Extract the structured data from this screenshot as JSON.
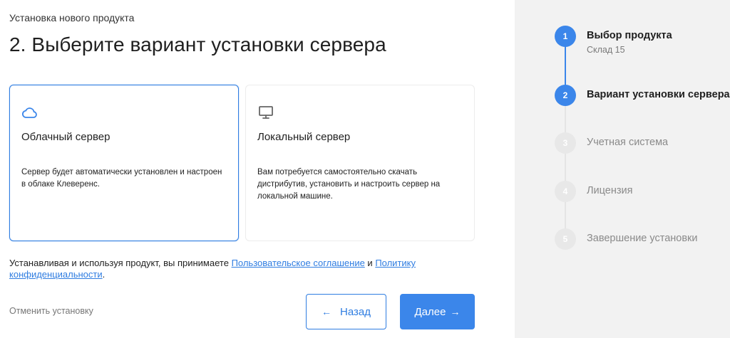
{
  "header": {
    "breadcrumb": "Установка нового продукта",
    "title": "2. Выберите вариант установки сервера"
  },
  "options": [
    {
      "icon": "cloud-icon",
      "title": "Облачный сервер",
      "description": "Сервер будет автоматически установлен и настроен в облаке Клеверенс.",
      "selected": true
    },
    {
      "icon": "monitor-icon",
      "title": "Локальный сервер",
      "description": "Вам потребуется самостоятельно скачать дистрибутив, установить и настроить сервер на локальной машине.",
      "selected": false
    }
  ],
  "agreement": {
    "prefix": "Устанавливая и используя продукт, вы принимаете ",
    "link1": "Пользовательское соглашение",
    "middle": " и ",
    "link2": "Политику конфиденциальности",
    "suffix": "."
  },
  "footer": {
    "cancel_label": "Отменить установку",
    "back_label": "Назад",
    "next_label": "Далее",
    "back_arrow": "←",
    "next_arrow": "→"
  },
  "steps": [
    {
      "number": "1",
      "label": "Выбор продукта",
      "sublabel": "Склад 15",
      "state": "done"
    },
    {
      "number": "2",
      "label": "Вариант установки сервера",
      "sublabel": "",
      "state": "current"
    },
    {
      "number": "3",
      "label": "Учетная система",
      "sublabel": "",
      "state": "pending"
    },
    {
      "number": "4",
      "label": "Лицензия",
      "sublabel": "",
      "state": "pending"
    },
    {
      "number": "5",
      "label": "Завершение установки",
      "sublabel": "",
      "state": "pending"
    }
  ],
  "colors": {
    "accent": "#3b86ea",
    "selected_border": "#2f7de1",
    "sidebar_bg": "#f2f2f2"
  }
}
